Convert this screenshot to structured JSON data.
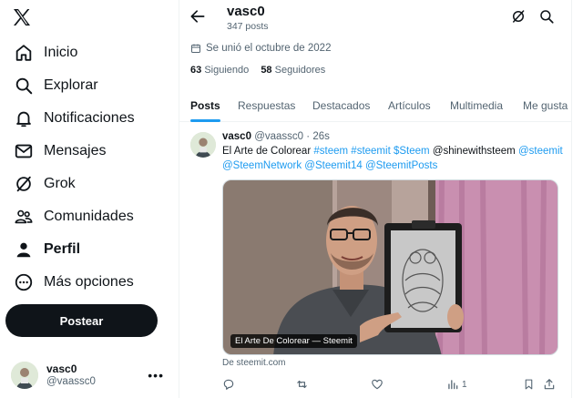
{
  "sidebar": {
    "logo": "x-logo-icon",
    "items": [
      {
        "label": "Inicio",
        "icon": "home-icon"
      },
      {
        "label": "Explorar",
        "icon": "search-icon"
      },
      {
        "label": "Notificaciones",
        "icon": "bell-icon"
      },
      {
        "label": "Mensajes",
        "icon": "mail-icon"
      },
      {
        "label": "Grok",
        "icon": "grok-icon"
      },
      {
        "label": "Comunidades",
        "icon": "people-icon"
      },
      {
        "label": "Perfil",
        "icon": "person-icon"
      },
      {
        "label": "Más opciones",
        "icon": "more-circle-icon"
      }
    ],
    "active_item": "Perfil",
    "post_button": "Postear",
    "account": {
      "name": "vasc0",
      "handle": "@vaassc0"
    }
  },
  "header": {
    "name": "vasc0",
    "posts_count": "347 posts"
  },
  "profile": {
    "joined": "Se unió el octubre de 2022",
    "following_count": "63",
    "following_label": "Siguiendo",
    "followers_count": "58",
    "followers_label": "Seguidores"
  },
  "tabs": [
    "Posts",
    "Respuestas",
    "Destacados",
    "Artículos",
    "Multimedia",
    "Me gusta"
  ],
  "active_tab": "Posts",
  "tweet": {
    "author": "vasc0",
    "handle": "@vaassc0",
    "time": "26s",
    "text_plain_1": "El Arte de Colorear",
    "tag_1": "#steem",
    "tag_2": "#steemit",
    "tag_3": "$Steem",
    "text_plain_2": "@shinewithsteem",
    "mention_1": "@steemit",
    "mention_2": "@SteemNetwork",
    "mention_3": "@Steemit14",
    "mention_4": "@SteemitPosts",
    "card_caption": "El Arte De Colorear — Steemit",
    "card_source": "De steemit.com",
    "views": "1"
  },
  "colors": {
    "accent": "#1d9bf0",
    "text_primary": "#0f1419",
    "text_secondary": "#536471",
    "post_button_bg": "#0f1419"
  }
}
